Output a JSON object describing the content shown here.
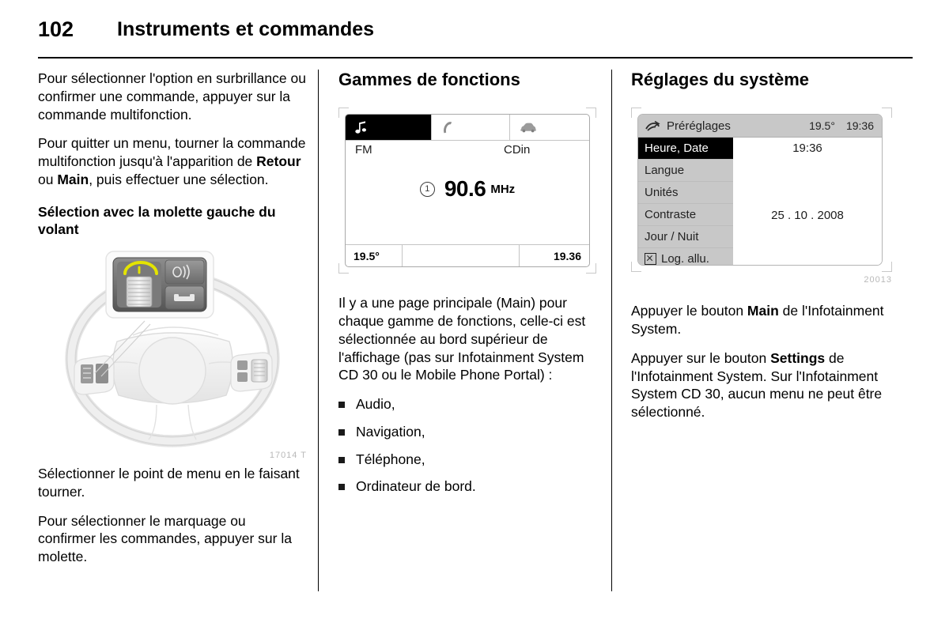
{
  "header": {
    "page_number": "102",
    "title": "Instruments et commandes"
  },
  "column1": {
    "para1": "Pour sélectionner l'option en surbrillance ou confirmer une commande, appuyer sur la commande multifonction.",
    "para2_part1": "Pour quitter un menu, tourner la commande multifonction jusqu'à l'apparition de ",
    "para2_bold1": "Retour",
    "para2_part2": " ou ",
    "para2_bold2": "Main",
    "para2_part3": ", puis effectuer une sélection.",
    "subheading": "Sélection avec la molette gauche du volant",
    "figure_caption": "17014 T",
    "para3": "Sélectionner le point de menu en le faisant tourner.",
    "para4": "Pour sélectionner le marquage ou confirmer les commandes, appuyer sur la molette."
  },
  "column2": {
    "section_title": "Gammes de fonctions",
    "radio_display": {
      "tabs": [
        {
          "icon": "music-note-icon",
          "active": true
        },
        {
          "icon": "phone-handset-icon",
          "active": false
        },
        {
          "icon": "car-icon",
          "active": false
        }
      ],
      "source_left": "FM",
      "source_right": "CDin",
      "preset_number": "1",
      "frequency": "90.6",
      "frequency_unit": "MHz",
      "status_temperature": "19.5°",
      "status_time": "19.36"
    },
    "para1_line": "Il y a une page principale (Main) pour chaque gamme de fonctions, celle-ci est sélectionnée au bord supérieur de l'affichage (pas sur Infotainment System CD 30 ou le Mobile Phone Portal) :",
    "bullets": [
      "Audio,",
      "Navigation,",
      "Téléphone,",
      "Ordinateur de bord."
    ]
  },
  "column3": {
    "section_title": "Réglages du système",
    "settings_display": {
      "header_icon": "settings-slider-icon",
      "header_title": "Préréglages",
      "header_temperature": "19.5°",
      "header_time": "19:36",
      "menu_items": [
        {
          "label": "Heure, Date",
          "selected": true,
          "checkbox": false
        },
        {
          "label": "Langue",
          "selected": false,
          "checkbox": false
        },
        {
          "label": "Unités",
          "selected": false,
          "checkbox": false
        },
        {
          "label": "Contraste",
          "selected": false,
          "checkbox": false
        },
        {
          "label": "Jour / Nuit",
          "selected": false,
          "checkbox": false
        },
        {
          "label": "Log. allu.",
          "selected": false,
          "checkbox": true
        }
      ],
      "value_time": "19:36",
      "value_date": "25 . 10 . 2008"
    },
    "figure_caption": "20013",
    "para1_part1": "Appuyer le bouton ",
    "para1_bold": "Main",
    "para1_part2": " de l'Infotainment System.",
    "para2_part1": "Appuyer sur le bouton ",
    "para2_bold": "Settings",
    "para2_part2": " de l'Infotainment System. Sur l'Infotainment System CD 30, aucun menu ne peut être sélectionné."
  },
  "colors": {
    "text": "#000000",
    "lcd_selected_bg": "#000000",
    "lcd_menu_bg": "#c8c8c8",
    "caption_gray": "#b8b8b8",
    "wheel_highlight": "#e3e300"
  }
}
